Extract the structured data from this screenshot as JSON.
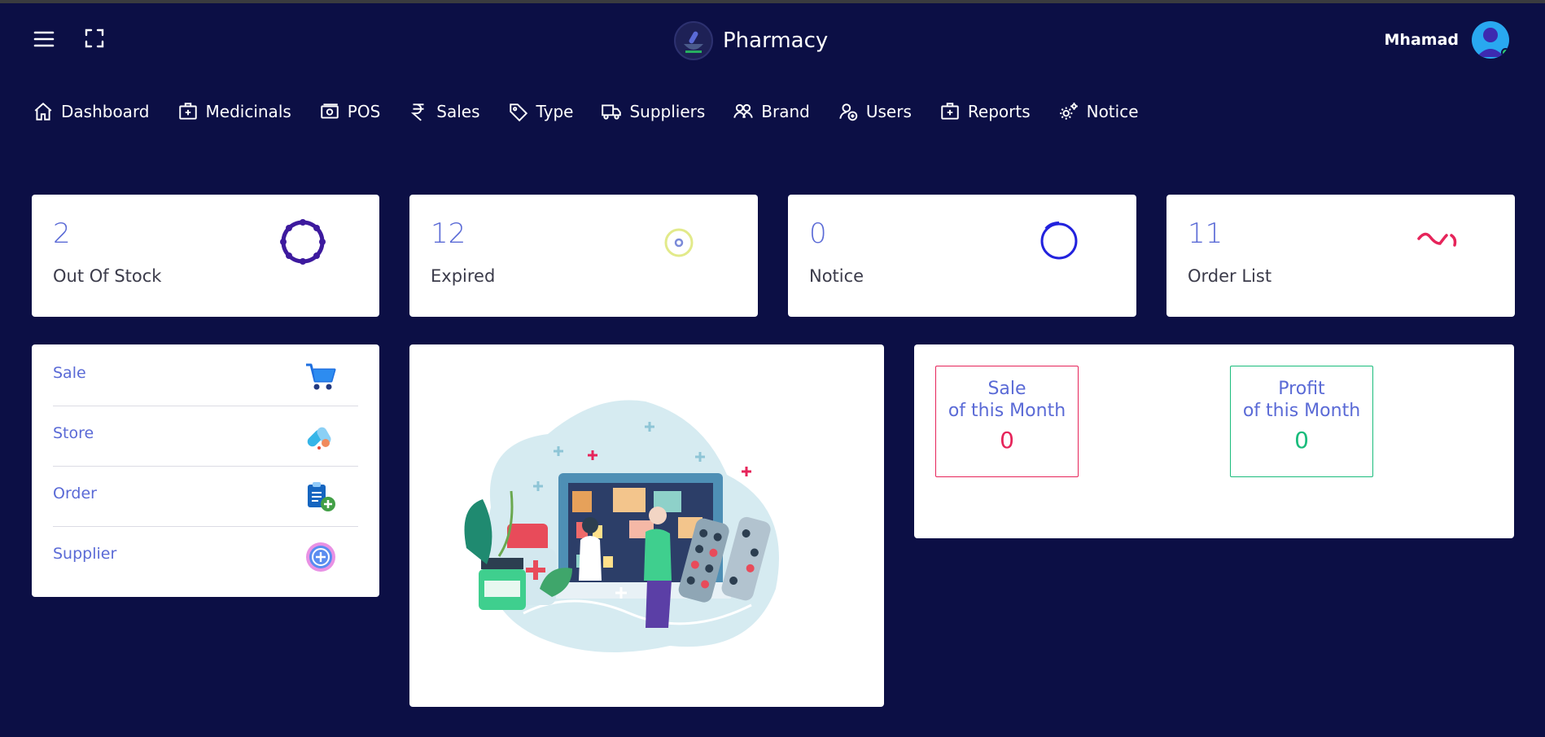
{
  "app": {
    "title": "Pharmacy",
    "user_name": "Mhamad"
  },
  "nav": [
    {
      "label": "Dashboard",
      "icon": "home-icon"
    },
    {
      "label": "Medicinals",
      "icon": "medical-kit-icon"
    },
    {
      "label": "POS",
      "icon": "cash-icon"
    },
    {
      "label": "Sales",
      "icon": "rupee-icon"
    },
    {
      "label": "Type",
      "icon": "tag-icon"
    },
    {
      "label": "Suppliers",
      "icon": "truck-icon"
    },
    {
      "label": "Brand",
      "icon": "group-icon"
    },
    {
      "label": "Users",
      "icon": "user-add-icon"
    },
    {
      "label": "Reports",
      "icon": "medical-kit-icon"
    },
    {
      "label": "Notice",
      "icon": "gears-icon"
    }
  ],
  "stats": [
    {
      "value": "2",
      "label": "Out Of Stock",
      "color": "#3d1a9e"
    },
    {
      "value": "12",
      "label": "Expired",
      "color": "#e2ea8a"
    },
    {
      "value": "0",
      "label": "Notice",
      "color": "#2222dd"
    },
    {
      "value": "11",
      "label": "Order List",
      "color": "#e6245a"
    }
  ],
  "quick_links": [
    {
      "label": "Sale",
      "icon": "cart-icon"
    },
    {
      "label": "Store",
      "icon": "pills-icon"
    },
    {
      "label": "Order",
      "icon": "clipboard-add-icon"
    },
    {
      "label": "Supplier",
      "icon": "plus-circle-icon"
    }
  ],
  "metrics": {
    "sale": {
      "line1": "Sale",
      "line2": "of this Month",
      "value": "0",
      "color": "#e6245a"
    },
    "profit": {
      "line1": "Profit",
      "line2": "of this Month",
      "value": "0",
      "color": "#1abc7c"
    }
  }
}
